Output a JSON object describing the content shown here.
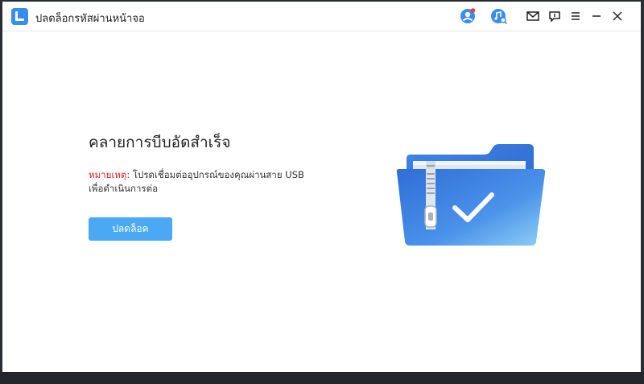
{
  "app": {
    "title": "ปลดล็อกรหัสผ่านหน้าจอ",
    "logo_icon": "app-logo-icon"
  },
  "titlebar": {
    "icons": [
      "user-account-icon",
      "music-search-icon",
      "mail-icon",
      "feedback-icon",
      "menu-icon",
      "minimize-icon",
      "close-icon"
    ],
    "notification_dot_color": "#f03a3a"
  },
  "main": {
    "title": "คลายการบีบอัดสำเร็จ",
    "note_label": "หมายเหตุ:",
    "note_text": " โปรดเชื่อมต่ออุปกรณ์ของคุณผ่านสาย USB เพื่อดำเนินการต่อ",
    "unlock_button": "ปลดล็อค"
  },
  "illustration": {
    "icon": "unzipped-folder-check-icon"
  },
  "colors": {
    "accent": "#4aa8f5",
    "note_label": "#e02020",
    "folder_blue": "#3a7be0"
  }
}
